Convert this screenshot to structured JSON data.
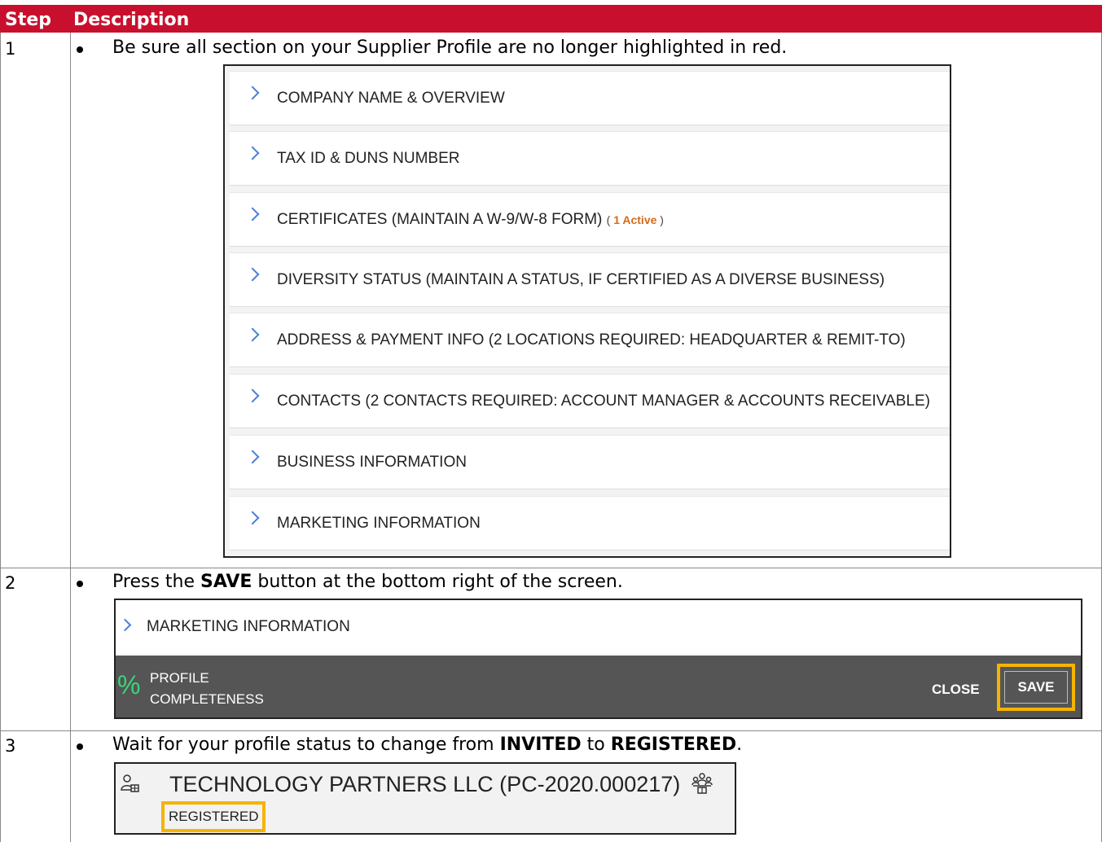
{
  "table": {
    "headers": [
      "Step",
      "Description"
    ],
    "rows": [
      {
        "step": "1",
        "instruction": "Be sure all section on your Supplier Profile are no longer highlighted in red."
      },
      {
        "step": "2",
        "instruction_pre": "Press the ",
        "instruction_bold": "SAVE",
        "instruction_post": " button at the bottom right of the screen."
      },
      {
        "step": "3",
        "instruction_pre": "Wait for your profile status to change from ",
        "instruction_bold1": "INVITED",
        "instruction_mid": " to ",
        "instruction_bold2": "REGISTERED",
        "instruction_post": "."
      }
    ]
  },
  "profile_sections": [
    "COMPANY NAME & OVERVIEW",
    "TAX ID & DUNS NUMBER",
    "CERTIFICATES (MAINTAIN A W-9/W-8 FORM)",
    "DIVERSITY STATUS (MAINTAIN A STATUS, IF CERTIFIED AS A DIVERSE BUSINESS)",
    "ADDRESS & PAYMENT INFO (2 LOCATIONS REQUIRED: HEADQUARTER & REMIT-TO)",
    "CONTACTS (2 CONTACTS REQUIRED: ACCOUNT MANAGER & ACCOUNTS RECEIVABLE)",
    "BUSINESS INFORMATION",
    "MARKETING INFORMATION"
  ],
  "certificates_badge": {
    "open": "( ",
    "text": "1 Active",
    "close": " )"
  },
  "save_screen": {
    "section_label": "MARKETING INFORMATION",
    "percent_symbol": "%",
    "completeness_line1": "PROFILE",
    "completeness_line2": "COMPLETENESS",
    "close_label": "CLOSE",
    "save_label": "SAVE"
  },
  "status_screen": {
    "company": "TECHNOLOGY PARTNERS LLC  (PC-2020.000217)",
    "status": "REGISTERED"
  },
  "colors": {
    "header_bg": "#c8102e",
    "highlight": "#f5b400",
    "chevron": "#4a7fd4",
    "percent": "#3cd47a"
  }
}
